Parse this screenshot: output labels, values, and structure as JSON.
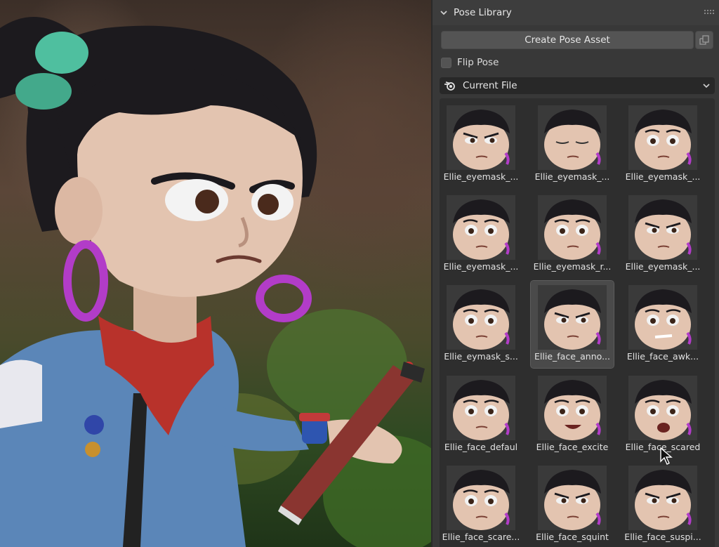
{
  "panel": {
    "title": "Pose Library",
    "create_button": "Create Pose Asset",
    "flip_label": "Flip Pose",
    "flip_checked": false,
    "library_dropdown": "Current File"
  },
  "poses": [
    {
      "label": "Ellie_eyemask_...",
      "expr": "angry"
    },
    {
      "label": "Ellie_eyemask_...",
      "expr": "closed"
    },
    {
      "label": "Ellie_eyemask_...",
      "expr": "worried"
    },
    {
      "label": "Ellie_eyemask_...",
      "expr": "surprised"
    },
    {
      "label": "Ellie_eyemask_r...",
      "expr": "bored"
    },
    {
      "label": "Ellie_eyemask_...",
      "expr": "squint"
    },
    {
      "label": "Ellie_eymask_s...",
      "expr": "wide"
    },
    {
      "label": "Ellie_face_anno...",
      "expr": "annoyed",
      "selected": true
    },
    {
      "label": "Ellie_face_awk...",
      "expr": "awkward"
    },
    {
      "label": "Ellie_face_defaul",
      "expr": "default"
    },
    {
      "label": "Ellie_face_excite",
      "expr": "excited"
    },
    {
      "label": "Ellie_face_scared",
      "expr": "scared"
    },
    {
      "label": "Ellie_face_scare...",
      "expr": "scared2"
    },
    {
      "label": "Ellie_face_squint",
      "expr": "squint2"
    },
    {
      "label": "Ellie_face_suspi...",
      "expr": "suspicious"
    }
  ],
  "colors": {
    "skin": "#e3c4b0",
    "hair": "#1c1a1e",
    "earring": "#b23cc8",
    "scrunchie": "#4fbf9f",
    "scarf": "#b8322b",
    "jacket": "#5b86b8"
  }
}
